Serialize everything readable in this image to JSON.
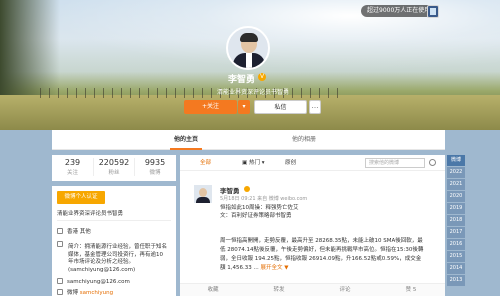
{
  "top": {
    "pill": "超过9000万人正在使用"
  },
  "profile": {
    "name": "李智勇",
    "bio": "清能业界资深评论员书智勇",
    "follow_label": "+关注",
    "message_label": "私信",
    "more_label": "▼"
  },
  "tabs": [
    {
      "label": "他的主页"
    },
    {
      "label": "他的相册"
    }
  ],
  "stats": [
    {
      "value": "239",
      "label": "关注"
    },
    {
      "value": "220592",
      "label": "粉丝"
    },
    {
      "value": "9935",
      "label": "微博"
    }
  ],
  "info": {
    "verified": "微博个人认证",
    "verified_desc": "清能业界资深评论员书智勇",
    "location": "香港 其他",
    "intro": "简介：拥清能源行业经验，曾任职于知名媒体，基金管理公司投资行，再有逾10年市场评论及分析之经验。(samchiyung@126.com)",
    "email": "samchiyung@126.com",
    "domain_prefix": "微博",
    "domain": "samchiyung",
    "tags_label": "个性域名"
  },
  "feed": {
    "tab_all": "全部",
    "tab_hot": "热门",
    "tab_origin": "原创",
    "search_placeholder": "搜索他的微博",
    "post": {
      "author": "李智勇",
      "meta": "5月18日 09:21 来自 微博 weibo.com",
      "text1": "恒指如此10周操：释强势亡佐艾\n文：百利好证券策略部书智勇",
      "text2": "周一恒指高開開，走勢反覆，最高升至 28268.35點，未能上破10 SMA後回軟，最低 28074.14點後反覆，午後走勢偏好，但未能再挑戰早市高位。恒指在15:30後轉弱，全日收報 194.25點，恒指收報 26914.09點，升166.52點或0.59%，成交金額 1,456.33 ...",
      "expand": "展开全文 ▼"
    },
    "actions": [
      "收藏",
      "转发",
      "评论",
      "赞 5"
    ]
  },
  "years": [
    "微博",
    "2022",
    "2021",
    "2020",
    "2019",
    "2018",
    "2017",
    "2016",
    "2015",
    "2014",
    "2013",
    "2012"
  ]
}
